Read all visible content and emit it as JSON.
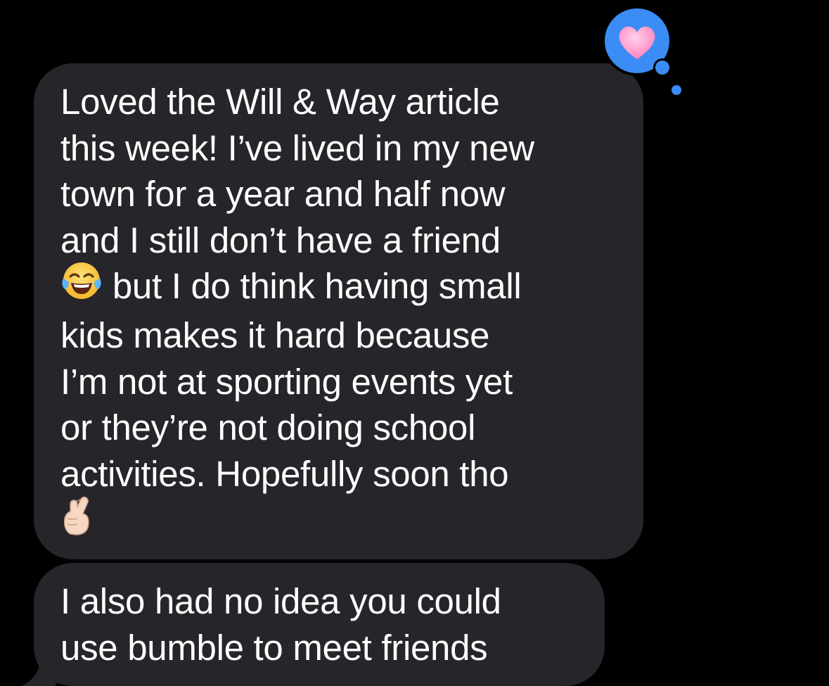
{
  "conversation": {
    "messages": [
      {
        "sender": "incoming",
        "lines": [
          "Loved the Will & Way article",
          "this week! I’ve lived in my new",
          "town for a year and half now",
          "and I still don’t have a friend",
          " but I do think having small",
          "kids makes it hard because",
          "I’m not at sporting events yet",
          "or they’re not doing school",
          "activities. Hopefully soon tho"
        ],
        "emojis": [
          "tears-of-joy-emoji",
          "crossed-fingers-emoji"
        ],
        "reaction": {
          "type": "heart-tapback",
          "icon": "heart-icon",
          "bubble_color": "#3b8cf5",
          "heart_color": "#ff8fc8"
        }
      },
      {
        "sender": "incoming",
        "lines": [
          "I also had no idea you could",
          "use bumble to meet friends"
        ]
      }
    ]
  },
  "theme": {
    "background": "#000000",
    "incoming_bubble": "#26252a",
    "text": "#ffffff"
  }
}
